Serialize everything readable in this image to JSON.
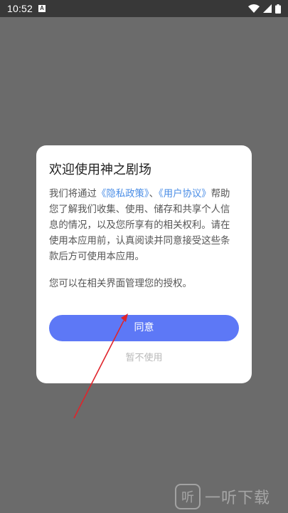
{
  "status_bar": {
    "time": "10:52",
    "app_badge": "A",
    "icons": [
      "wifi-icon",
      "signal-icon",
      "battery-icon"
    ]
  },
  "dialog": {
    "title": "欢迎使用神之剧场",
    "body_prefix": "我们将通过",
    "privacy_link": "《隐私政策》",
    "separator": "、",
    "user_agreement_link": "《用户协议》",
    "body_suffix": "帮助您了解我们收集、使用、储存和共享个人信息的情况，以及您所享有的相关权利。请在使用本应用前，认真阅读并同意接受这些条款后方可使用本应用。",
    "note": "您可以在相关界面管理您的授权。",
    "agree_label": "同意",
    "decline_label": "暂不使用"
  },
  "colors": {
    "overlay": "#6b6b6b",
    "link": "#4a8de6",
    "primary_button": "#5d78f6",
    "annotation_arrow": "#e0242b"
  },
  "watermark": {
    "text": "一听下载"
  }
}
